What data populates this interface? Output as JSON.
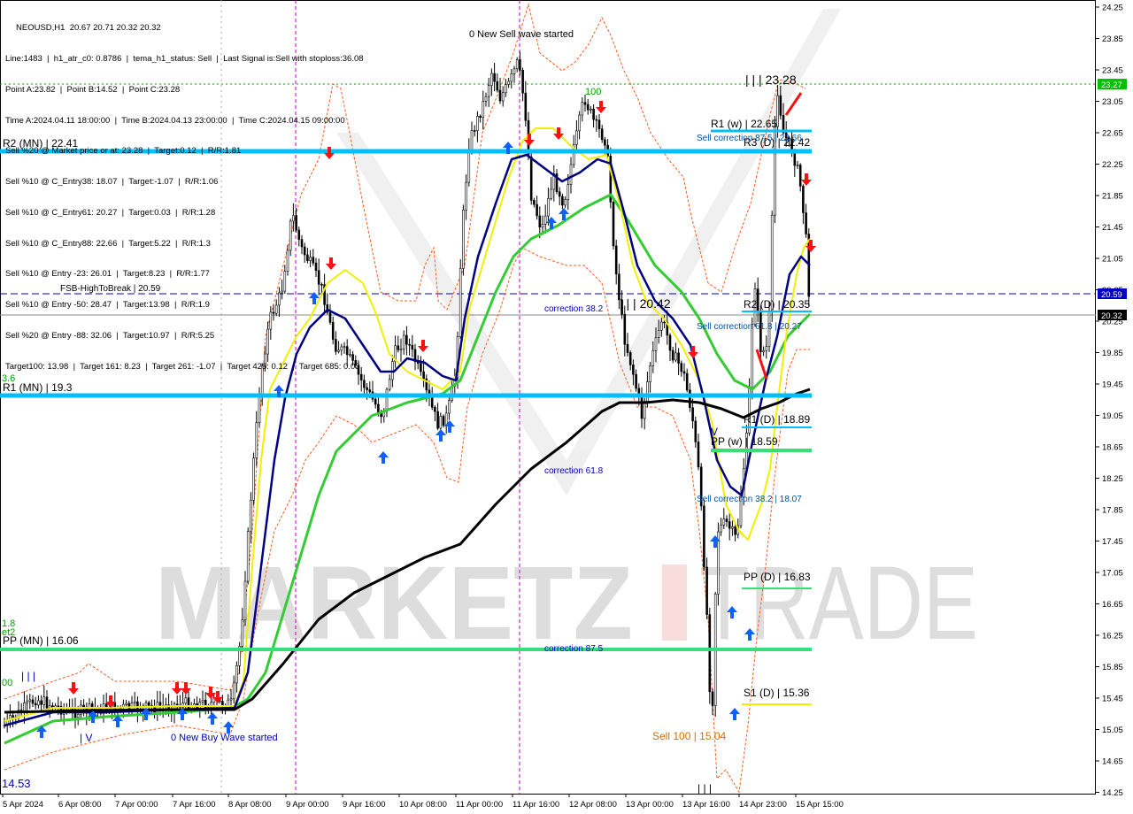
{
  "header": {
    "symbol_line": "NEOUSD,H1  20.67 20.71 20.32 20.32",
    "info_lines": [
      "Line:1483  |  h1_atr_c0: 0.8786  |  tema_h1_status: Sell  |  Last Signal is:Sell with stoploss:36.08",
      "Point A:23.82  |  Point B:14.52  |  Point C:23.28",
      "Time A:2024.04.11 18:00:00  |  Time B:2024.04.13 23:00:00  |  Time C:2024.04.15 09:00:00",
      "Sell %20 @ Market price or at: 23.28  |  Target:0.12  |  R/R:1.81",
      "Sell %10 @ C_Entry38: 18.07  |  Target:-1.07  |  R/R:1.06",
      "Sell %10 @ C_Entry61: 20.27  |  Target:0.03  |  R/R:1.28",
      "Sell %10 @ C_Entry88: 22.66  |  Target:5.22  |  R/R:1.3",
      "Sell %10 @ Entry -23: 26.01  |  Target:8.23  |  R/R:1.77",
      "Sell %10 @ Entry -50: 28.47  |  Target:13.98  |  R/R:1.9",
      "Sell %20 @ Entry -88: 32.06  |  Target:10.97  |  R/R:5.25",
      "Target100: 13.98  |  Target 161: 8.23  |  Target 261: -1.07  |  Target 423: 0.12  |  Target 685: 0.03"
    ]
  },
  "watermark": {
    "left": "MARKETZ",
    "right": "TRADE"
  },
  "price_axis": {
    "ticks": [
      "24.25",
      "23.85",
      "23.45",
      "23.05",
      "22.65",
      "22.25",
      "21.85",
      "21.45",
      "21.05",
      "20.65",
      "20.25",
      "19.85",
      "19.45",
      "19.05",
      "18.65",
      "18.25",
      "17.85",
      "17.45",
      "17.05",
      "16.65",
      "16.25",
      "15.85",
      "15.45",
      "15.05",
      "14.65",
      "14.25"
    ],
    "current_green": "23.27",
    "current_blue": "20.59",
    "current_dark": "20.32"
  },
  "time_axis": {
    "ticks": [
      "5 Apr 2024",
      "6 Apr 08:00",
      "7 Apr 00:00",
      "7 Apr 16:00",
      "8 Apr 08:00",
      "9 Apr 00:00",
      "9 Apr 16:00",
      "10 Apr 08:00",
      "11 Apr 00:00",
      "11 Apr 16:00",
      "12 Apr 08:00",
      "13 Apr 00:00",
      "13 Apr 16:00",
      "14 Apr 23:00",
      "15 Apr 15:00"
    ]
  },
  "levels": {
    "r2_mn": "R2 (MN) | 22.41",
    "r1_mn": "R1 (MN) | 19.3",
    "pp_mn": "PP (MN) | 16.06",
    "fsb": "FSB-HighToBreak | 20.59",
    "r1_w": "R1 (w) | 22.65",
    "r3_d": "R3 (D) | 22.42",
    "r2_d": "R2 (D) | 20.35",
    "r1_d": "R1 (D) | 18.89",
    "pp_w": "PP (w) | 18.59",
    "pp_d": "PP (D) | 16.83",
    "s1_d": "S1 (D) | 15.36"
  },
  "annotations": {
    "sell_wave": "0 New Sell wave started",
    "buy_wave": "0 New Buy Wave started",
    "high": "| | | 23.28",
    "mid": "| | | 20.42",
    "sell_corr_87": "Sell correction 87.5 | 22.66",
    "sell_corr_61": "Sell correction 61.8 | 20.27",
    "sell_corr_38": "Sell correction 38.2 | 18.07",
    "corr_38": "correction 38.2",
    "corr_61": "correction 61.8",
    "corr_87": "correction 87.5",
    "sell_100": "Sell 100 | 15.04",
    "low_left": "14.53",
    "label_100": "100",
    "left_36": "3.6",
    "left_18": "1.8",
    "left_et2": "et2",
    "left_00": "00",
    "mark_v1": "| V",
    "mark_v2": "V",
    "mark_bars_left": "| | |",
    "mark_bars_bottom": "| | |"
  },
  "colors": {
    "green_line": "#00c000",
    "level_blue": "#00bfff",
    "level_green": "#33e07a",
    "yellow_ma": "#f0f000",
    "green_ma": "#33cc33",
    "navy_ma": "#000080",
    "black_ma": "#000000",
    "red_channel": "#ff5a1f",
    "arrow_up": "#1060ff",
    "arrow_down": "#ff1010"
  }
}
